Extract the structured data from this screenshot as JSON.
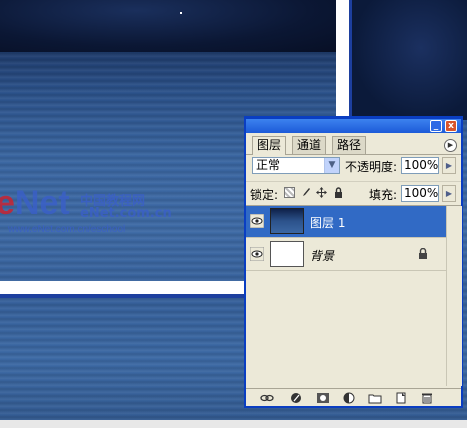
{
  "watermark": {
    "logo_e": "e",
    "logo_rest": "Net",
    "chinese": "中国教程网",
    "domain": "eNet.com.cn",
    "url": "www.eNet.com.cn/eschool"
  },
  "layers_panel": {
    "tabs": [
      {
        "label": "图层",
        "active": true
      },
      {
        "label": "通道",
        "active": false
      },
      {
        "label": "路径",
        "active": false
      }
    ],
    "window_buttons": {
      "minimize": "_",
      "close": "x"
    },
    "blend_mode": "正常",
    "opacity_label": "不透明度:",
    "opacity_value": "100%",
    "lock_label": "锁定:",
    "fill_label": "填充:",
    "fill_value": "100%",
    "layers": [
      {
        "name": "图层 1",
        "selected": true,
        "visible": true,
        "thumbnail": "ocean-night"
      },
      {
        "name": "背景",
        "selected": false,
        "visible": true,
        "locked": true,
        "thumbnail": "white"
      }
    ],
    "toolbar_icons": [
      "link-layers-icon",
      "layer-style-icon",
      "layer-mask-icon",
      "adjustment-layer-icon",
      "new-group-icon",
      "new-layer-icon",
      "delete-layer-icon"
    ]
  },
  "colors": {
    "title_bar": "#1c5ad8",
    "selected_row": "#316ac5",
    "panel_bg": "#ece9d8",
    "close_button": "#d9552b"
  }
}
